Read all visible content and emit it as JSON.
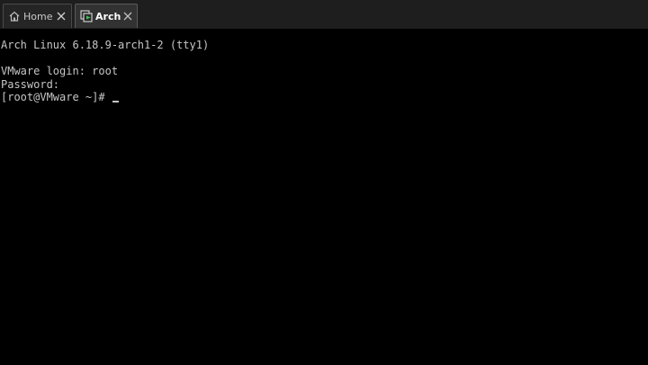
{
  "tabs": [
    {
      "label": "Home",
      "icon": "home-icon"
    },
    {
      "label": "Arch",
      "icon": "vm-icon",
      "active": true
    }
  ],
  "terminal": {
    "lines": [
      "Arch Linux 6.18.9-arch1-2 (tty1)",
      "",
      "VMware login: root",
      "Password:",
      "[root@VMware ~]# "
    ]
  },
  "colors": {
    "terminal_bg": "#000000",
    "terminal_fg": "#c6c6c6",
    "tabbar_bg": "#1e1e1e",
    "vm_icon_accent": "#3cc85a"
  }
}
